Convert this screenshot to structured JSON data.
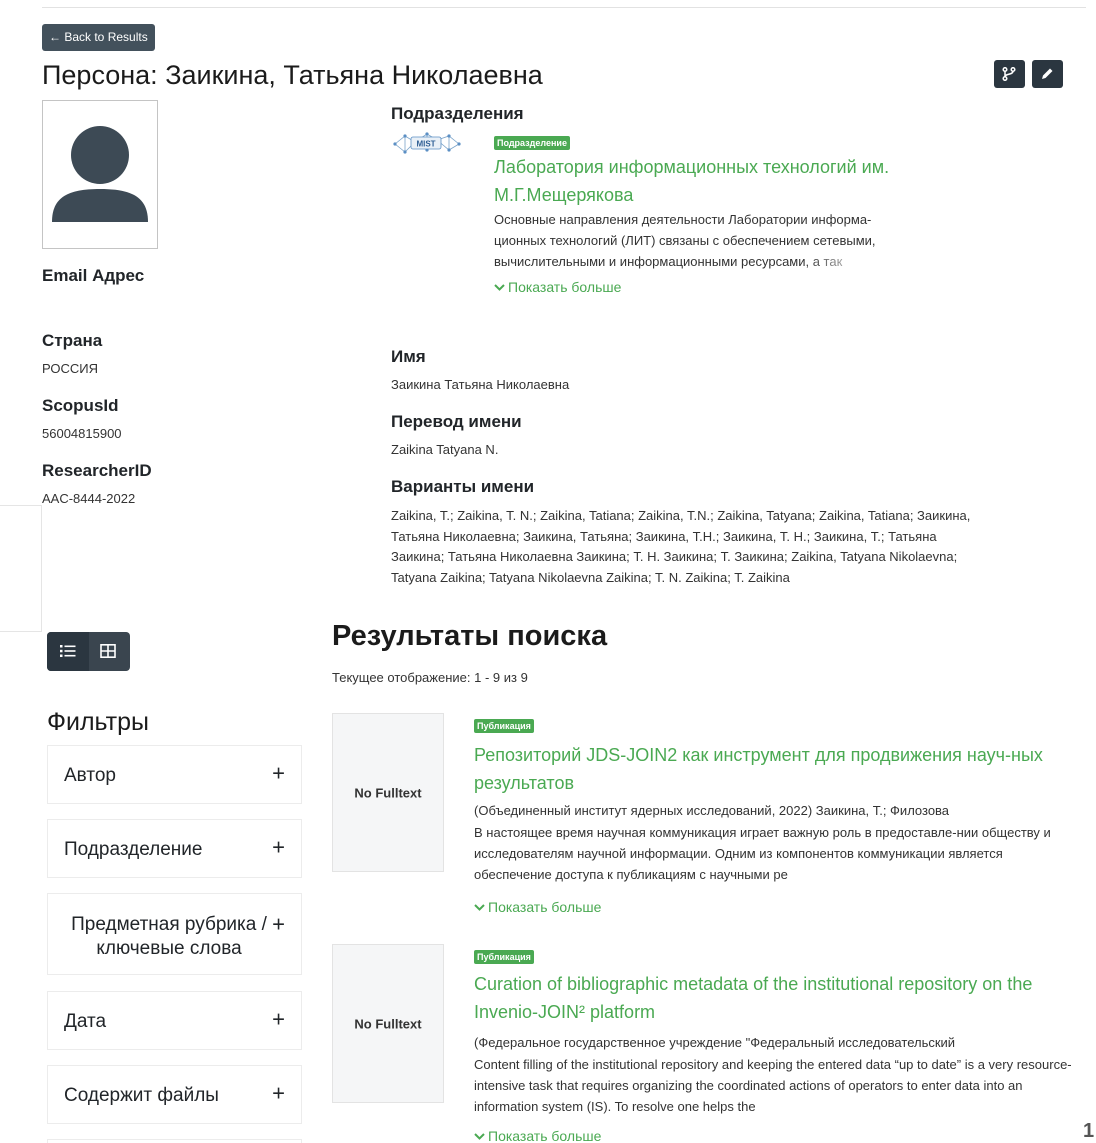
{
  "back_button": "← Back to Results",
  "page_title": "Персона: Заикина, Татьяна Николаевна",
  "header_actions": [
    "fork-icon",
    "pencil-icon"
  ],
  "person": {
    "email_label": "Email Адрес",
    "country_label": "Страна",
    "country_value": "РОССИЯ",
    "scopus_label": "ScopusId",
    "scopus_value": "56004815900",
    "researcher_label": "ResearcherID",
    "researcher_value": "AAC-8444-2022"
  },
  "departments": {
    "heading": "Подразделения",
    "logo_text": "MIST",
    "badge": "Подразделение",
    "title": "Лаборатория информационных технологий им. М.Г.Мещерякова",
    "description": "Основные направления деятельности Лаборатории информа-ционных технологий (ЛИТ) связаны с обеспечением сетевыми, вычислительными и информационными ресурсами, а так",
    "more": "Показать больше"
  },
  "names": {
    "name_label": "Имя",
    "name_value": "Заикина Татьяна Николаевна",
    "translation_label": "Перевод имени",
    "translation_value": "Zaikina Tatyana N.",
    "variants_label": "Варианты имени",
    "variants_value": "Zaikina, T.; Zaikina, T. N.; Zaikina, Tatiana; Zaikina, T.N.; Zaikina, Tatyana; Zaikina, Tatiana; Заикина, Татьяна Николаевна; Заикина, Татьяна; Заикина, Т.Н.; Заикина, Т. Н.; Заикина, Т.; Татьяна Заикина; Татьяна Николаевна Заикина; Т. Н. Заикина; Т. Заикина; Zaikina, Tatyana Nikolaevna; Tatyana Zaikina; Tatyana Nikolaevna Zaikina; T. N. Zaikina; T. Zaikina"
  },
  "filters": {
    "title": "Фильтры",
    "items": [
      {
        "label": "Автор"
      },
      {
        "label": "Подразделение"
      },
      {
        "label": "Предметная рубрика / ключевые слова"
      },
      {
        "label": "Дата"
      },
      {
        "label": "Содержит файлы"
      }
    ],
    "plus": "+"
  },
  "results": {
    "title": "Результаты поиска",
    "count": "Текущее отображение: 1 - 9 из 9",
    "items": [
      {
        "thumb": "No Fulltext",
        "badge": "Публикация",
        "title": "Репозиторий JDS-JOIN2 как инструмент для продвижения науч-ных результатов",
        "meta": "(Объединенный институт ядерных исследований, 2022) Заикина, Т.; Филозова",
        "abstract": "В настоящее время научная коммуникация играет важную роль в предоставле-нии обществу и исследователям научной информации. Одним из компонентов коммуникации является обеспечение доступа к публикациям с научными ре",
        "more": "Показать больше"
      },
      {
        "thumb": "No Fulltext",
        "badge": "Публикация",
        "title": "Curation of bibliographic metadata of the institutional repository on the Invenio-JOIN² platform",
        "meta": "(Федеральное государственное учреждение \"Федеральный исследовательский",
        "abstract": "Content filling of the institutional repository and keeping the entered data “up to date” is a very resource-intensive task that requires organizing the coordinated actions of operators to enter data into an information system (IS). To resolve one helps the",
        "more": "Показать больше"
      }
    ]
  },
  "page_number": "1",
  "colors": {
    "accent_green": "#4aa952",
    "dark_button": "#2b3640"
  }
}
